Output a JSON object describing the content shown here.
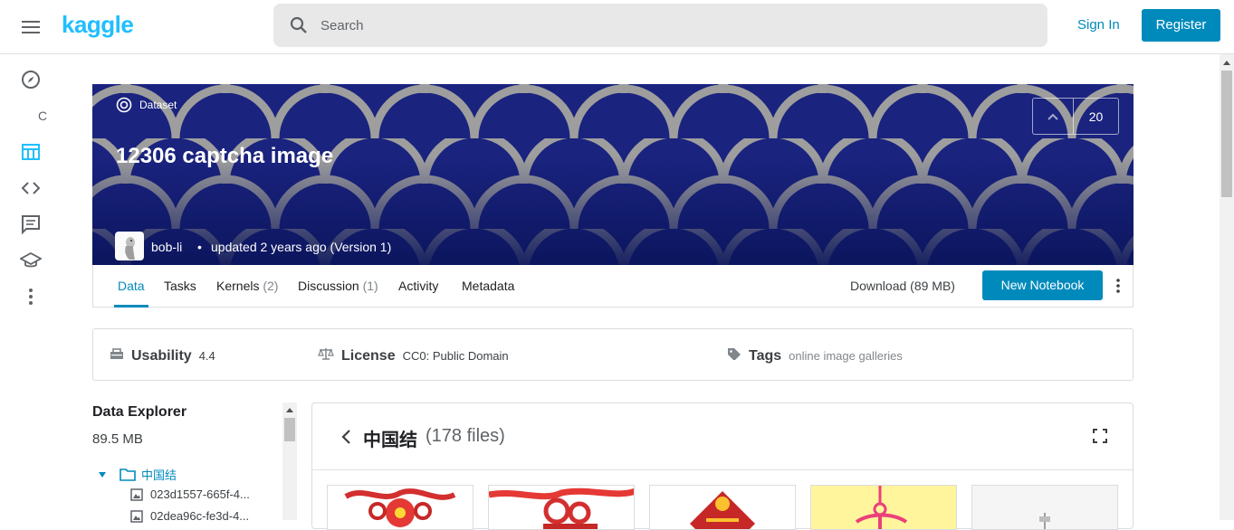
{
  "header": {
    "logo": "kaggle",
    "search_placeholder": "Search",
    "sign_in": "Sign In",
    "register": "Register"
  },
  "leftnav": {
    "items": [
      "compass-icon",
      "table-icon",
      "code-icon",
      "comment-icon",
      "school-icon",
      "more-icon"
    ],
    "stray_letter": "C"
  },
  "dataset": {
    "type_label": "Dataset",
    "title": "12306 captcha image",
    "author": "bob-li",
    "separator": "•",
    "updated": "updated 2 years ago (Version 1)",
    "votes": "20"
  },
  "tabs": [
    {
      "label": "Data",
      "count": ""
    },
    {
      "label": "Tasks",
      "count": ""
    },
    {
      "label": "Kernels",
      "count": "(2)"
    },
    {
      "label": "Discussion",
      "count": "(1)"
    },
    {
      "label": "Activity",
      "count": ""
    },
    {
      "label": "Metadata",
      "count": ""
    }
  ],
  "actions": {
    "download": "Download (89 MB)",
    "new_notebook": "New Notebook"
  },
  "meta": {
    "usability_label": "Usability",
    "usability_value": "4.4",
    "license_label": "License",
    "license_value": "CC0: Public Domain",
    "tags_label": "Tags",
    "tags_value": "online image galleries"
  },
  "explorer": {
    "title": "Data Explorer",
    "size": "89.5 MB",
    "folder": "中国结",
    "files": [
      "023d1557-665f-4...",
      "02dea96c-fe3d-4..."
    ]
  },
  "viewer": {
    "folder_name": "中国结",
    "file_count": "(178 files)"
  },
  "colors": {
    "accent": "#008abc",
    "logo": "#20beff",
    "hero_bg": "#1a237e"
  }
}
